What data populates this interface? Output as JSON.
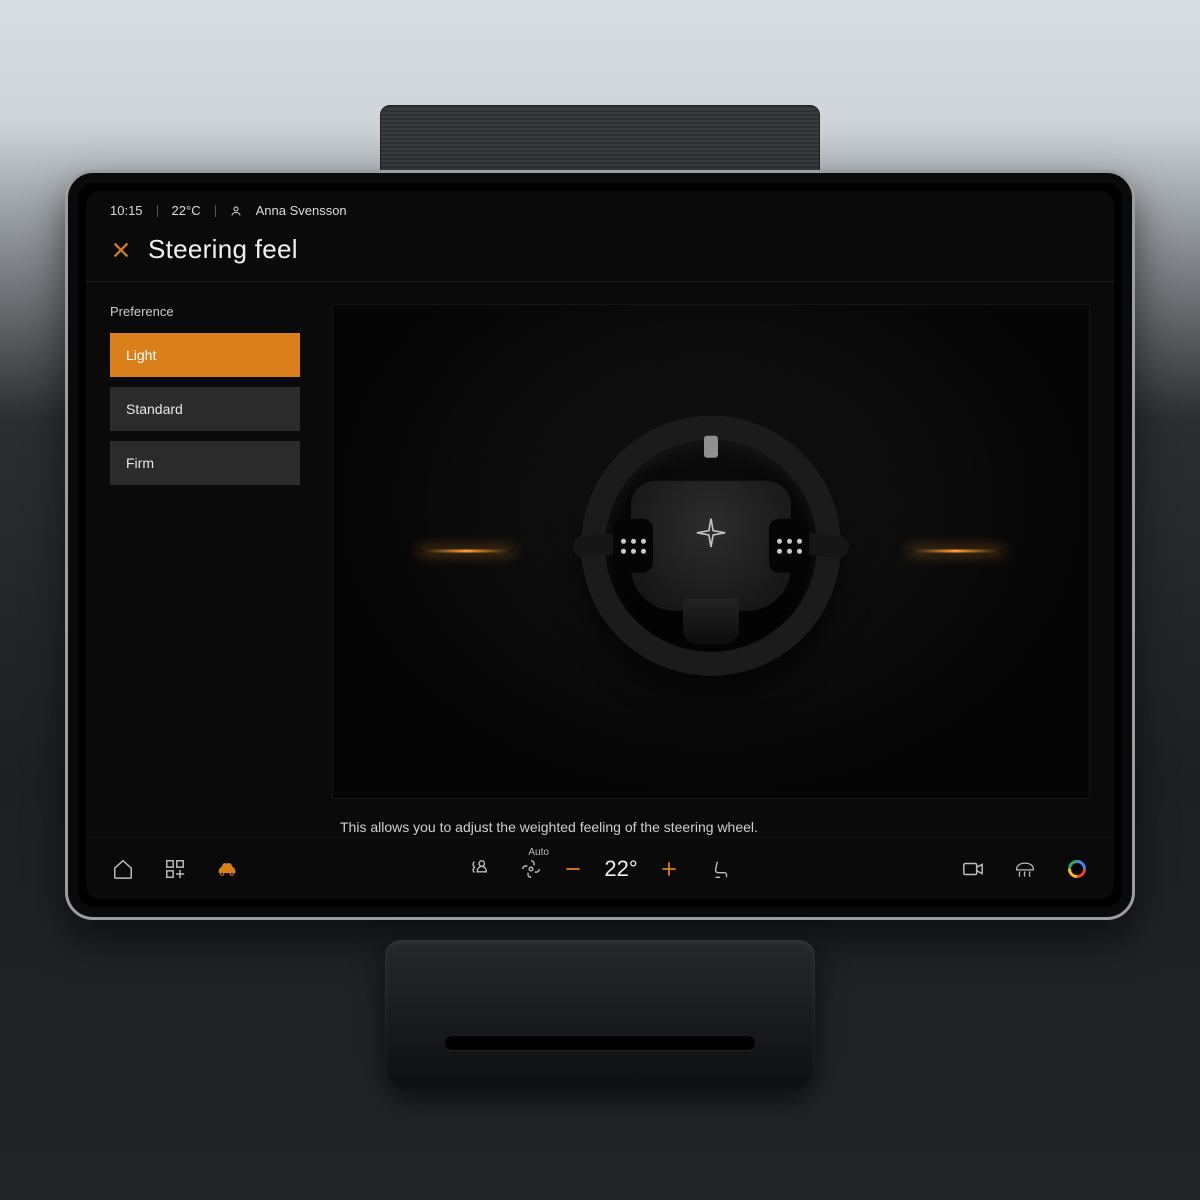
{
  "status": {
    "time": "10:15",
    "temperature": "22°C",
    "user": "Anna Svensson"
  },
  "header": {
    "title": "Steering feel"
  },
  "sidebar": {
    "section_label": "Preference",
    "options": [
      "Light",
      "Standard",
      "Firm"
    ],
    "selected_index": 0
  },
  "preview": {
    "description": "This allows you to adjust the weighted feeling of the steering wheel."
  },
  "bottombar": {
    "climate_mode": "Auto",
    "climate_temp": "22°"
  },
  "colors": {
    "accent": "#d9801a"
  }
}
